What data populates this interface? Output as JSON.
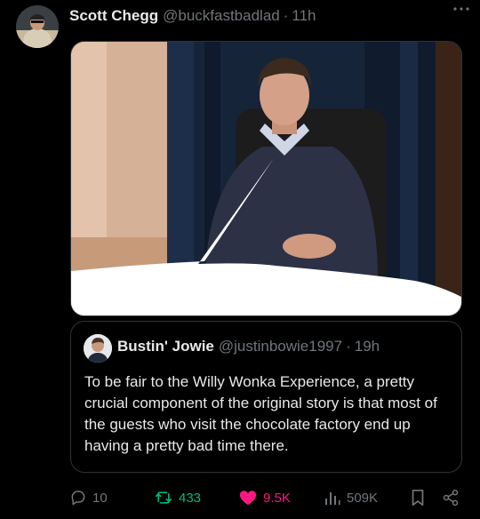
{
  "tweet": {
    "author_name": "Scott Chegg",
    "author_handle": "@buckfastbadlad",
    "separator": "·",
    "time": "11h",
    "more_icon": "more-icon"
  },
  "quote": {
    "author_name": "Bustin' Jowie",
    "author_handle": "@justinbowie1997",
    "separator": "·",
    "time": "19h",
    "text": "To be fair to the Willy Wonka Experience, a pretty crucial component of the original story is that most of the guests who visit the chocolate factory end up having a pretty bad time there."
  },
  "actions": {
    "replies": "10",
    "reposts": "433",
    "likes": "9.5K",
    "views": "509K"
  },
  "colors": {
    "background": "#000000",
    "text": "#e7e9ea",
    "muted": "#71767b",
    "border": "#2f3336",
    "repost": "#00ba7c",
    "like": "#f91880"
  }
}
